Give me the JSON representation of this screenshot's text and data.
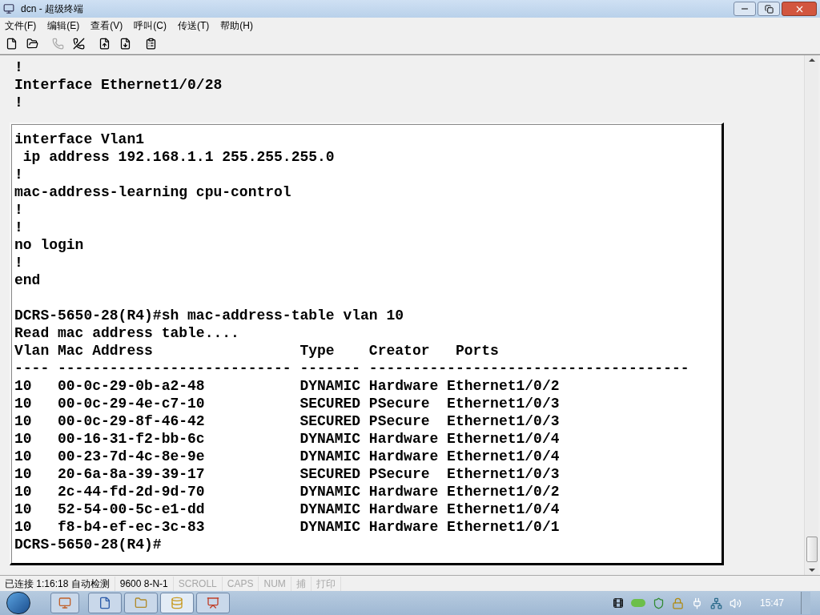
{
  "window": {
    "title": "dcn - 超级终端"
  },
  "menu": [
    "文件(F)",
    "编辑(E)",
    "查看(V)",
    "呼叫(C)",
    "传送(T)",
    "帮助(H)"
  ],
  "toolbar": [
    {
      "kind": "new",
      "disabled": false
    },
    {
      "kind": "open",
      "disabled": false
    },
    {
      "kind": "call",
      "disabled": true
    },
    {
      "kind": "hangup",
      "disabled": false
    },
    {
      "kind": "send",
      "disabled": false
    },
    {
      "kind": "receive",
      "disabled": false
    },
    {
      "kind": "properties",
      "disabled": false
    }
  ],
  "terminal": {
    "background_lines": [
      "!",
      "Interface Ethernet1/0/28",
      "!"
    ],
    "config_lines": [
      "interface Vlan1",
      " ip address 192.168.1.1 255.255.255.0",
      "!",
      "mac-address-learning cpu-control",
      "!",
      "!",
      "no login",
      "!",
      "end"
    ],
    "session_lines": [
      "DCRS-5650-28(R4)#sh mac-address-table vlan 10",
      "Read mac address table....",
      "Vlan Mac Address                 Type    Creator   Ports",
      "---- --------------------------- ------- -------------------------------------",
      "10   00-0c-29-0b-a2-48           DYNAMIC Hardware Ethernet1/0/2",
      "10   00-0c-29-4e-c7-10           SECURED PSecure  Ethernet1/0/3",
      "10   00-0c-29-8f-46-42           SECURED PSecure  Ethernet1/0/3",
      "10   00-16-31-f2-bb-6c           DYNAMIC Hardware Ethernet1/0/4",
      "10   00-23-7d-4c-8e-9e           DYNAMIC Hardware Ethernet1/0/4",
      "10   20-6a-8a-39-39-17           SECURED PSecure  Ethernet1/0/3",
      "10   2c-44-fd-2d-9d-70           DYNAMIC Hardware Ethernet1/0/2",
      "10   52-54-00-5c-e1-dd           DYNAMIC Hardware Ethernet1/0/4",
      "10   f8-b4-ef-ec-3c-83           DYNAMIC Hardware Ethernet1/0/1",
      "DCRS-5650-28(R4)#"
    ]
  },
  "status_bar": [
    {
      "text": "已连接 1:16:18 自动检测",
      "active": true
    },
    {
      "text": "9600 8-N-1",
      "active": true
    },
    {
      "text": "SCROLL",
      "active": false
    },
    {
      "text": "CAPS",
      "active": false
    },
    {
      "text": "NUM",
      "active": false
    },
    {
      "text": "捕",
      "active": false
    },
    {
      "text": "打印",
      "active": false
    }
  ],
  "taskbar": {
    "clock": "15:47"
  }
}
